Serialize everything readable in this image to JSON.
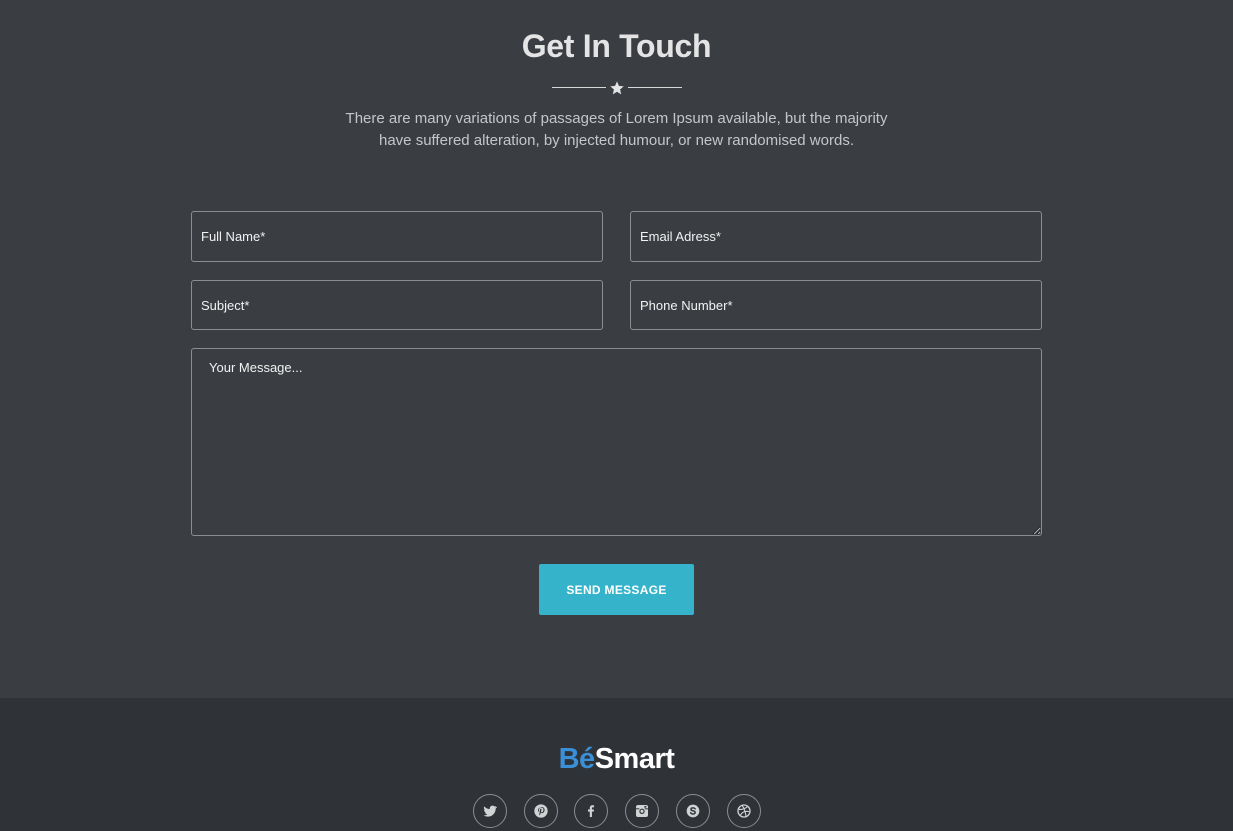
{
  "contact": {
    "title": "Get In Touch",
    "subtitle_line1": "There are many variations of passages of Lorem Ipsum available, but the majority",
    "subtitle_line2": "have suffered alteration, by injected humour, or new randomised words.",
    "form": {
      "full_name_placeholder": "Full Name*",
      "email_placeholder": "Email Adress*",
      "subject_placeholder": "Subject*",
      "phone_placeholder": "Phone Number*",
      "message_placeholder": "Your Message...",
      "send_label": "SEND MESSAGE"
    }
  },
  "footer": {
    "logo_accent": "Bé",
    "logo_rest": "Smart",
    "social_icons": [
      "twitter-icon",
      "pinterest-icon",
      "facebook-icon",
      "instagram-icon",
      "skype-icon",
      "dribbble-icon"
    ]
  },
  "colors": {
    "background": "#3a3e43",
    "footer_background": "#2f3237",
    "button": "#35b3ca",
    "logo_accent": "#3a8fd6"
  }
}
